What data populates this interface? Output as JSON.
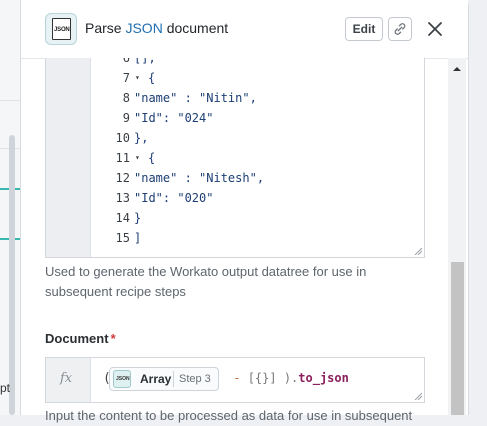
{
  "header": {
    "app_icon_text": "JSON",
    "title_prefix": "Parse ",
    "title_accent": "JSON",
    "title_suffix": " document",
    "edit_label": "Edit",
    "link_icon": "link-icon",
    "close_icon": "close-icon"
  },
  "code_editor": {
    "lines": [
      {
        "num": "6",
        "fold": "",
        "text": "[],"
      },
      {
        "num": "7",
        "fold": "▾",
        "text": "{"
      },
      {
        "num": "8",
        "fold": "",
        "text": "\"name\" : \"Nitin\","
      },
      {
        "num": "9",
        "fold": "",
        "text": "\"Id\": \"024\""
      },
      {
        "num": "10",
        "fold": "",
        "text": "},"
      },
      {
        "num": "11",
        "fold": "▾",
        "text": "{"
      },
      {
        "num": "12",
        "fold": "",
        "text": "\"name\" : \"Nitesh\","
      },
      {
        "num": "13",
        "fold": "",
        "text": "\"Id\": \"020\""
      },
      {
        "num": "14",
        "fold": "",
        "text": "}"
      },
      {
        "num": "15",
        "fold": "",
        "text": "]"
      }
    ],
    "helper_text": "Used to generate the Workato output datatree for use in subsequent recipe steps"
  },
  "document_field": {
    "label": "Document",
    "required_mark": "*",
    "fx_label": "fx",
    "paren_open": "(",
    "pill": {
      "icon_text": "JSON",
      "field": "Array",
      "step": "Step 3"
    },
    "formula_op": " - ",
    "formula_brackets": "[{}]",
    "formula_close": " ).",
    "formula_method": "to_json",
    "helper_text": "Input the content to be processed as data for use in subsequent"
  },
  "background": {
    "partial_text": "pt"
  },
  "colors": {
    "accent_blue": "#1f6fb2",
    "teal": "#39b7b0",
    "required": "#d23b3b"
  }
}
